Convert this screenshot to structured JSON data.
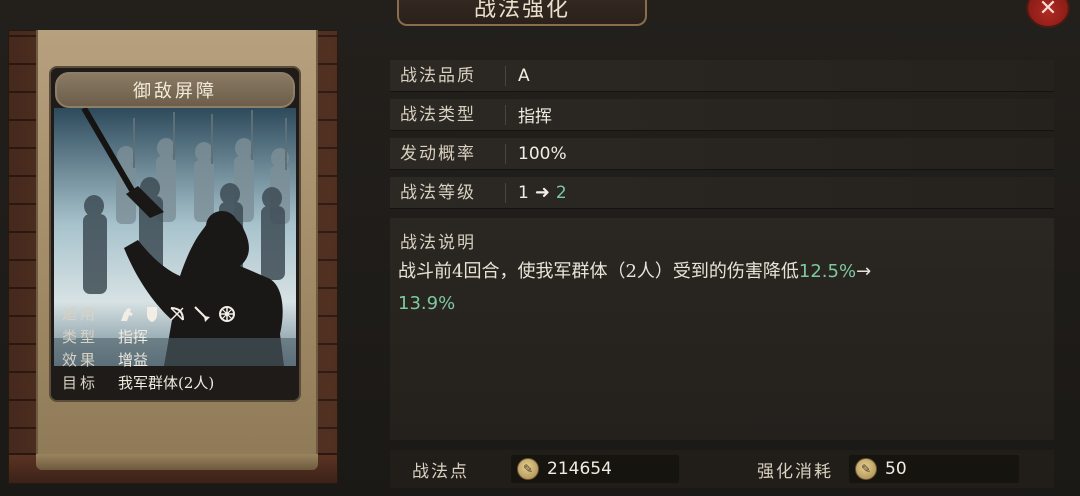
{
  "window": {
    "title": "战法强化",
    "close_symbol": "✕"
  },
  "skill_card": {
    "name": "御敌屏障",
    "info": [
      {
        "key": "适用",
        "value": ""
      },
      {
        "key": "类型",
        "value": "指挥"
      },
      {
        "key": "效果",
        "value": "增益"
      },
      {
        "key": "目标",
        "value": "我军群体(2人)"
      }
    ],
    "applicable_icons": [
      "cavalry-icon",
      "shield-icon",
      "bow-icon",
      "spear-icon",
      "wheel-icon"
    ]
  },
  "attributes": [
    {
      "key": "战法品质",
      "value": "A"
    },
    {
      "key": "战法类型",
      "value": "指挥"
    },
    {
      "key": "发动概率",
      "value": "100%"
    },
    {
      "key": "战法等级",
      "from": "1",
      "to": "2"
    }
  ],
  "description": {
    "label": "战法说明",
    "text_before": "战斗前4回合，使我军群体（2人）受到的伤害降低",
    "old_value": "12.5%",
    "arrow": "→",
    "new_value": "13.9%"
  },
  "costs": {
    "points_label": "战法点",
    "points_value": "214654",
    "upgrade_label": "强化消耗",
    "upgrade_value": "50"
  },
  "colors": {
    "highlight_green": "#7cc9a0",
    "close_red": "#b02a23"
  }
}
